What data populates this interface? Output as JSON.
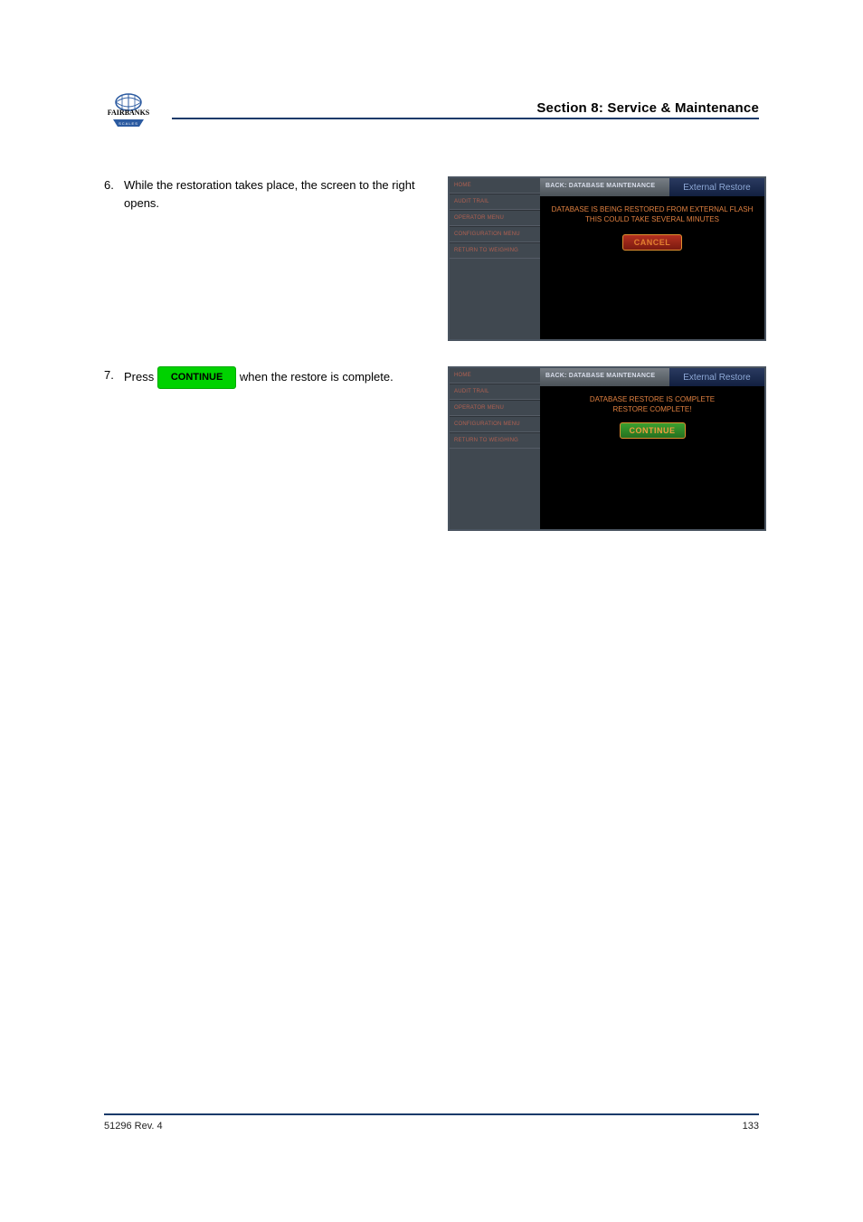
{
  "header": {
    "section_title": "Section 8:  Service & Maintenance"
  },
  "steps": [
    {
      "num": "6.",
      "text": "While the restoration takes place, the screen to the right opens."
    },
    {
      "num": "7.",
      "before": "Press ",
      "btn": "CONTINUE",
      "after": " when the restore is complete."
    }
  ],
  "mini_sidebar": {
    "items": [
      "HOME",
      "AUDIT TRAIL",
      "OPERATOR MENU",
      "CONFIGURATION MENU",
      "RETURN TO WEIGHING"
    ]
  },
  "mini1": {
    "back": "BACK: DATABASE MAINTENANCE",
    "rtitle": "External Restore",
    "line1": "DATABASE IS BEING RESTORED FROM EXTERNAL FLASH",
    "line2": "THIS COULD TAKE SEVERAL MINUTES",
    "btn": "CANCEL"
  },
  "mini2": {
    "back": "BACK: DATABASE MAINTENANCE",
    "rtitle": "External Restore",
    "line1": "DATABASE RESTORE IS COMPLETE",
    "line2": "RESTORE COMPLETE!",
    "btn": "CONTINUE"
  },
  "footer": {
    "left": "51296 Rev. 4",
    "right": "133"
  }
}
